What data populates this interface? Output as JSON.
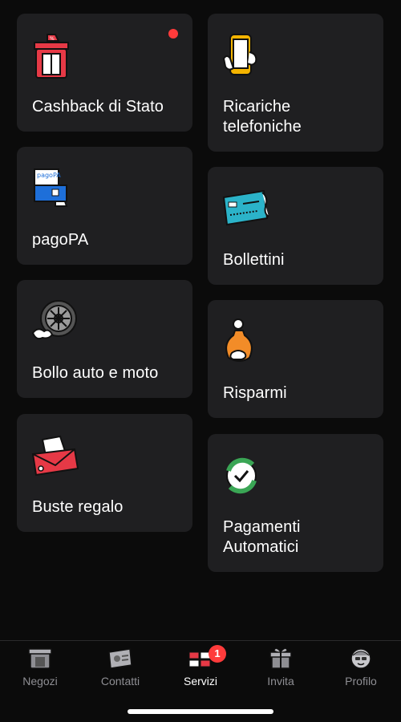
{
  "services_left": [
    {
      "label": "Cashback di Stato",
      "icon": "cashback-store-icon",
      "has_notification": true
    },
    {
      "label": "pagoPA",
      "icon": "pagopa-receipt-icon"
    },
    {
      "label": "Bollo auto e moto",
      "icon": "tire-wheel-icon"
    },
    {
      "label": "Buste regalo",
      "icon": "gift-envelope-icon"
    }
  ],
  "services_right": [
    {
      "label": "Ricariche\ntelefoniche",
      "icon": "phone-topup-icon"
    },
    {
      "label": "Bollettini",
      "icon": "bank-slip-icon"
    },
    {
      "label": "Risparmi",
      "icon": "savings-bag-icon"
    },
    {
      "label": "Pagamenti\nAutomatici",
      "icon": "auto-payment-refresh-icon"
    }
  ],
  "tabbar": {
    "tabs": [
      {
        "label": "Negozi",
        "icon": "store-icon"
      },
      {
        "label": "Contatti",
        "icon": "contacts-card-icon"
      },
      {
        "label": "Servizi",
        "icon": "services-cards-icon",
        "badge": "1",
        "active": true
      },
      {
        "label": "Invita",
        "icon": "gift-box-icon"
      },
      {
        "label": "Profilo",
        "icon": "profile-face-icon"
      }
    ]
  },
  "colors": {
    "background": "#0b0b0b",
    "card": "#1f1f21",
    "accent_red": "#ff3b3b",
    "inactive_text": "#8e8e93"
  }
}
